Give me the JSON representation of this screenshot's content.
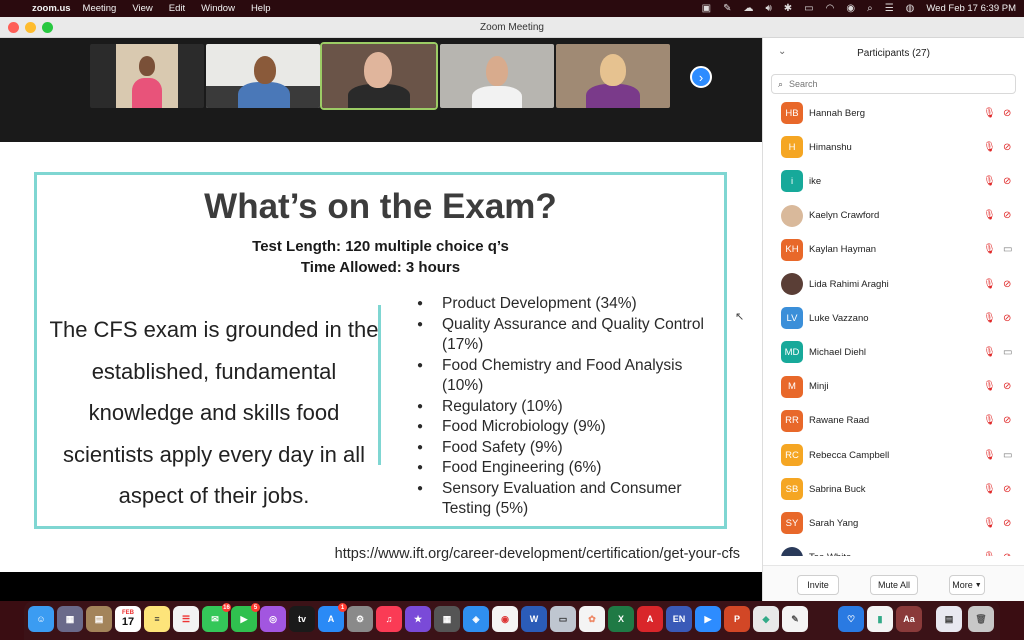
{
  "menubar": {
    "app": "zoom.us",
    "menus": [
      "Meeting",
      "View",
      "Edit",
      "Window",
      "Help"
    ],
    "clock": "Wed Feb 17  6:39 PM"
  },
  "window": {
    "title": "Zoom Meeting"
  },
  "slide": {
    "title": "What’s on the Exam?",
    "line1": "Test Length: 120 multiple choice q’s",
    "line2": "Time Allowed: 3 hours",
    "body": "The CFS exam is grounded in the established, fundamental knowledge and skills food scientists apply every day in all aspect of their jobs.",
    "items": [
      "Product Development (34%)",
      "Quality Assurance and Quality Control (17%)",
      "Food Chemistry and Food Analysis (10%)",
      "Regulatory (10%)",
      "Food Microbiology (9%)",
      "Food Safety (9%)",
      "Food Engineering (6%)",
      "Sensory Evaluation and Consumer Testing (5%)"
    ],
    "url": "https://www.ift.org/career-development/certification/get-your-cfs"
  },
  "participants": {
    "title": "Participants (27)",
    "search_placeholder": "Search",
    "list": [
      {
        "initials": "HB",
        "name": "Hannah Berg",
        "color": "#e8682a",
        "cam": "off"
      },
      {
        "initials": "H",
        "name": "Himanshu",
        "color": "#f5a623",
        "cam": "off"
      },
      {
        "initials": "i",
        "name": "ike",
        "color": "#17a99a",
        "cam": "off"
      },
      {
        "initials": "",
        "name": "Kaelyn Crawford",
        "color": "#d9b99b",
        "cam": "off"
      },
      {
        "initials": "KH",
        "name": "Kaylan Hayman",
        "color": "#e8682a",
        "cam": "on"
      },
      {
        "initials": "",
        "name": "Lida Rahimi Araghi",
        "color": "#5a3e36",
        "cam": "off"
      },
      {
        "initials": "LV",
        "name": "Luke Vazzano",
        "color": "#3b8fd9",
        "cam": "off"
      },
      {
        "initials": "MD",
        "name": "Michael Diehl",
        "color": "#17a99a",
        "cam": "on"
      },
      {
        "initials": "M",
        "name": "Minji",
        "color": "#e8682a",
        "cam": "off"
      },
      {
        "initials": "RR",
        "name": "Rawane Raad",
        "color": "#e8682a",
        "cam": "off"
      },
      {
        "initials": "RC",
        "name": "Rebecca Campbell",
        "color": "#f5a623",
        "cam": "on"
      },
      {
        "initials": "SB",
        "name": "Sabrina Buck",
        "color": "#f5a623",
        "cam": "off"
      },
      {
        "initials": "SY",
        "name": "Sarah Yang",
        "color": "#e8682a",
        "cam": "off"
      },
      {
        "initials": "",
        "name": "Tea White",
        "color": "#2a3a5a",
        "cam": "off"
      }
    ],
    "buttons": {
      "invite": "Invite",
      "mute_all": "Mute All",
      "more": "More"
    }
  },
  "dock": {
    "calendar_day": "17",
    "calendar_month": "FEB",
    "badges": {
      "messages": "16",
      "facetime": "5",
      "appstore": "1"
    }
  }
}
